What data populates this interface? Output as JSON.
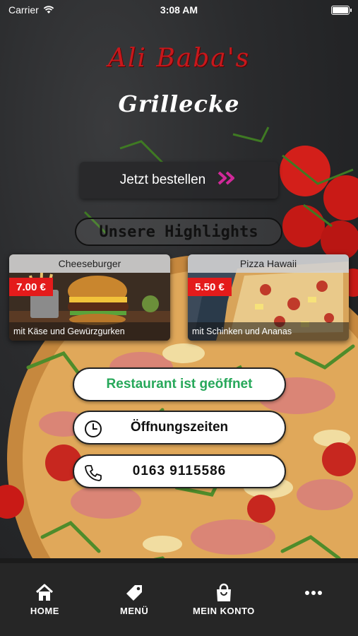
{
  "status_bar": {
    "carrier": "Carrier",
    "time": "3:08 AM"
  },
  "brand": {
    "name": "Ali Baba's",
    "subtitle": "Grillecke"
  },
  "order_button": {
    "label": "Jetzt bestellen",
    "arrow": "»"
  },
  "highlights": {
    "title": "Unsere Highlights",
    "items": [
      {
        "name": "Cheeseburger",
        "price": "7.00 €",
        "description": "mit Käse und Gewürzgurken"
      },
      {
        "name": "Pizza Hawaii",
        "price": "5.50 €",
        "description": "mit Schinken und Ananas"
      }
    ]
  },
  "restaurant_status": {
    "label": "Restaurant ist geöffnet",
    "color": "#27a85a"
  },
  "opening_hours": {
    "label": "Öffnungszeiten",
    "icon": "clock-icon"
  },
  "phone": {
    "label": "0163 9115586",
    "icon": "phone-icon"
  },
  "tabbar": {
    "items": [
      {
        "label": "HOME",
        "icon": "home-icon"
      },
      {
        "label": "MENÜ",
        "icon": "tag-icon"
      },
      {
        "label": "MEIN KONTO",
        "icon": "shopping-bag-icon"
      },
      {
        "label": "",
        "icon": "more-icon"
      }
    ]
  },
  "colors": {
    "brand_red": "#c8181c",
    "price_red": "#e41b1b",
    "accent_pink": "#d1299a",
    "tabbar_bg": "#262626"
  }
}
